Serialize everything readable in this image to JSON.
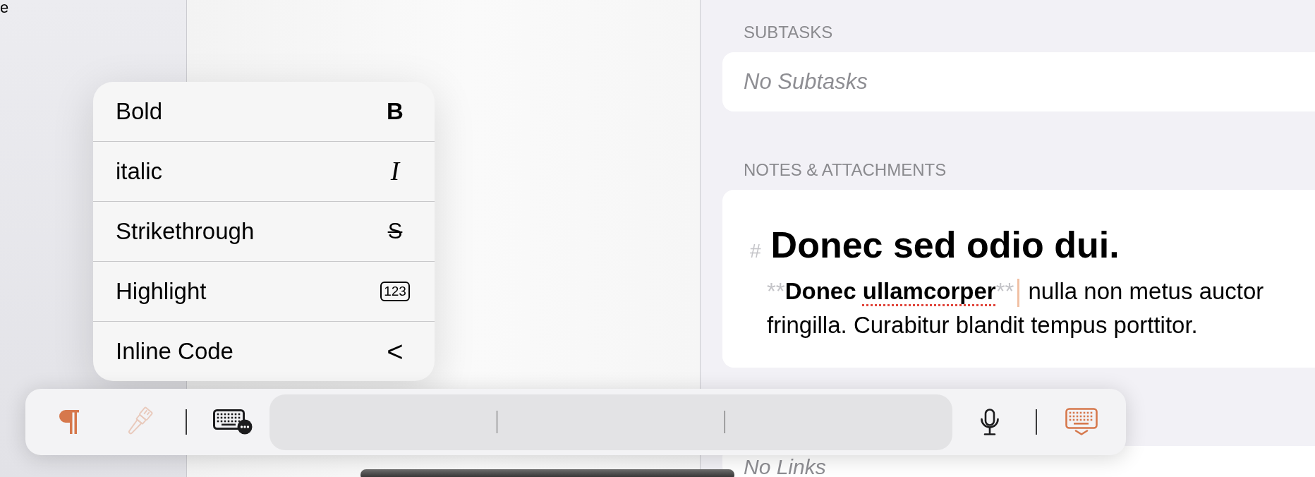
{
  "sidebar": {
    "text": "e"
  },
  "format_menu": {
    "items": [
      {
        "label": "Bold",
        "glyph": "B",
        "kind": "bold"
      },
      {
        "label": "italic",
        "glyph": "I",
        "kind": "italic"
      },
      {
        "label": "Strikethrough",
        "glyph": "S",
        "kind": "strikethrough"
      },
      {
        "label": "Highlight",
        "glyph": "123",
        "kind": "boxed"
      },
      {
        "label": "Inline Code",
        "glyph": "<",
        "kind": "code"
      }
    ]
  },
  "detail": {
    "sections": [
      {
        "kind": "list",
        "header": "SUBTASKS",
        "empty_text": "No Subtasks"
      },
      {
        "kind": "note",
        "header": "NOTES & ATTACHMENTS",
        "note": {
          "heading_marker": "#",
          "heading": "Donec sed odio dui.",
          "paragraph": [
            {
              "kind": "marker",
              "text": "**"
            },
            {
              "kind": "bold",
              "text": "Donec "
            },
            {
              "kind": "bold-misspelled",
              "text": "ullamcorper"
            },
            {
              "kind": "marker",
              "text": "**"
            },
            {
              "kind": "cursor"
            },
            {
              "kind": "plain",
              "text": " nulla non metus auctor fringilla. Curabitur blandit tempus porttitor."
            }
          ]
        }
      },
      {
        "kind": "list",
        "empty_text": "No Links"
      }
    ]
  },
  "toolbar": {
    "format_buttons": [
      {
        "kind": "paragraph",
        "disabled": false
      },
      {
        "kind": "brush",
        "disabled": true
      }
    ],
    "input_buttons": [
      {
        "kind": "keyboard-options",
        "disabled": false
      }
    ],
    "voice_buttons": [
      {
        "kind": "microphone",
        "disabled": false
      }
    ],
    "keyboard_buttons": [
      {
        "kind": "keyboard-dismiss",
        "disabled": false
      }
    ]
  }
}
